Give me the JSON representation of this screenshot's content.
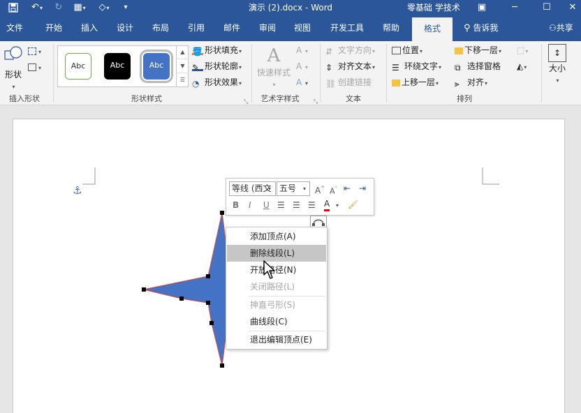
{
  "window": {
    "title": "演示 (2).docx  -  Word",
    "account": "零基础 学技术"
  },
  "tabs": [
    "文件",
    "开始",
    "插入",
    "设计",
    "布局",
    "引用",
    "邮件",
    "审阅",
    "视图",
    "开发工具",
    "帮助",
    "格式"
  ],
  "tell_me": "告诉我",
  "share": "共享",
  "ribbon": {
    "insert_shapes": {
      "shapes_label": "形状",
      "group_label": "插入形状"
    },
    "shape_styles": {
      "swatches": [
        "Abc",
        "Abc",
        "Abc"
      ],
      "fill": "形状填充",
      "outline": "形状轮廓",
      "effects": "形状效果",
      "group_label": "形状样式"
    },
    "wordart": {
      "quick_styles": "快速样式",
      "group_label": "艺术字样式"
    },
    "text": {
      "direction": "文字方向",
      "align": "对齐文本",
      "link": "创建链接",
      "group_label": "文本"
    },
    "arrange": {
      "position": "位置",
      "wrap": "环绕文字",
      "forward": "上移一层",
      "backward": "下移一层",
      "selection_pane": "选择窗格",
      "align": "对齐",
      "group_label": "排列"
    },
    "size": {
      "label": "大小"
    }
  },
  "mini_toolbar": {
    "font": "等线 (西文",
    "size": "五号",
    "bold": "B",
    "italic": "I",
    "underline": "U",
    "font_color_letter": "A"
  },
  "context_menu": {
    "items": [
      {
        "label": "添加顶点(A)",
        "enabled": true,
        "highlighted": false
      },
      {
        "label": "删除线段(L)",
        "enabled": true,
        "highlighted": true
      },
      {
        "label": "开放路径(N)",
        "enabled": true,
        "highlighted": false
      },
      {
        "label": "关闭路径(L)",
        "enabled": false,
        "highlighted": false
      },
      {
        "label": "抻直弓形(S)",
        "enabled": false,
        "highlighted": false
      },
      {
        "label": "曲线段(C)",
        "enabled": true,
        "highlighted": false
      },
      {
        "label": "退出编辑顶点(E)",
        "enabled": true,
        "highlighted": false
      }
    ]
  },
  "colors": {
    "brand": "#2b579a",
    "shape_fill": "#4472c4",
    "shape_outline": "#c0504d",
    "menu_highlight": "#c6c6c6"
  },
  "icons": {
    "save": "save-icon",
    "undo": "undo-icon",
    "redo": "redo-icon",
    "anchor": "anchor-icon"
  }
}
